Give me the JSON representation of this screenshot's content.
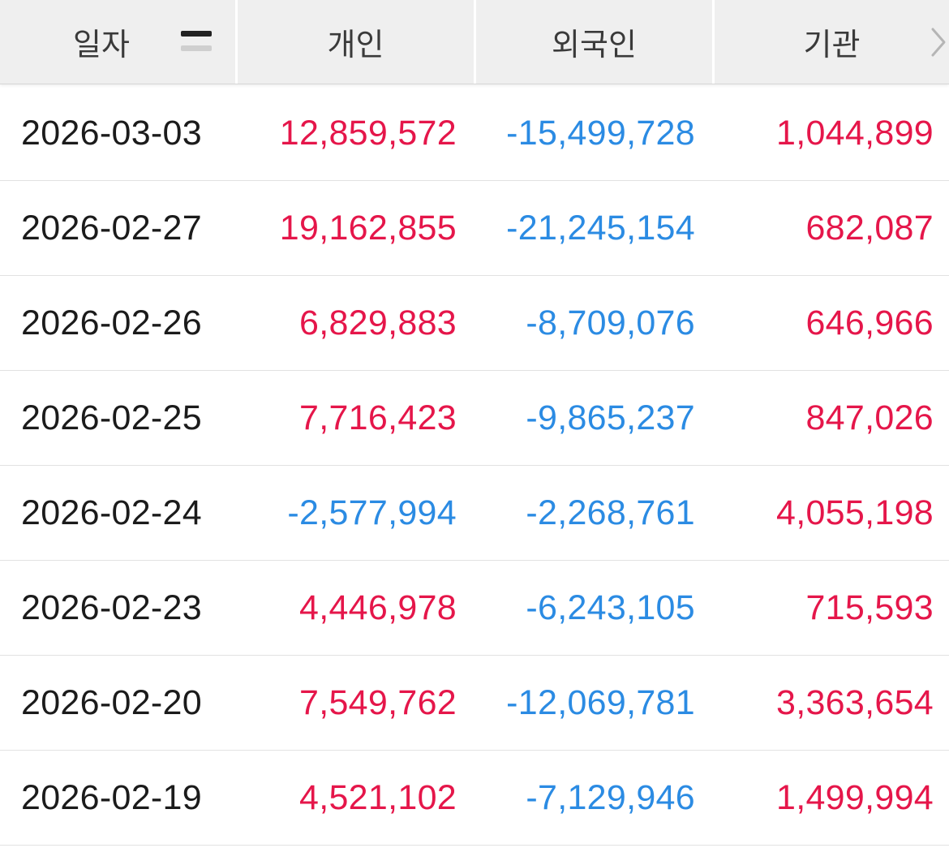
{
  "header": {
    "date_label": "일자",
    "individual_label": "개인",
    "foreign_label": "외국인",
    "institution_label": "기관"
  },
  "colors": {
    "positive": "#e5164a",
    "negative": "#2b8be3",
    "header_bg": "#efefef"
  },
  "icons": {
    "sort": "sort-descending-icon",
    "more": "chevron-right-icon"
  },
  "rows": [
    {
      "date": "2026-03-03",
      "individual": "12,859,572",
      "foreign": "-15,499,728",
      "institution": "1,044,899"
    },
    {
      "date": "2026-02-27",
      "individual": "19,162,855",
      "foreign": "-21,245,154",
      "institution": "682,087"
    },
    {
      "date": "2026-02-26",
      "individual": "6,829,883",
      "foreign": "-8,709,076",
      "institution": "646,966"
    },
    {
      "date": "2026-02-25",
      "individual": "7,716,423",
      "foreign": "-9,865,237",
      "institution": "847,026"
    },
    {
      "date": "2026-02-24",
      "individual": "-2,577,994",
      "foreign": "-2,268,761",
      "institution": "4,055,198"
    },
    {
      "date": "2026-02-23",
      "individual": "4,446,978",
      "foreign": "-6,243,105",
      "institution": "715,593"
    },
    {
      "date": "2026-02-20",
      "individual": "7,549,762",
      "foreign": "-12,069,781",
      "institution": "3,363,654"
    },
    {
      "date": "2026-02-19",
      "individual": "4,521,102",
      "foreign": "-7,129,946",
      "institution": "1,499,994"
    }
  ]
}
